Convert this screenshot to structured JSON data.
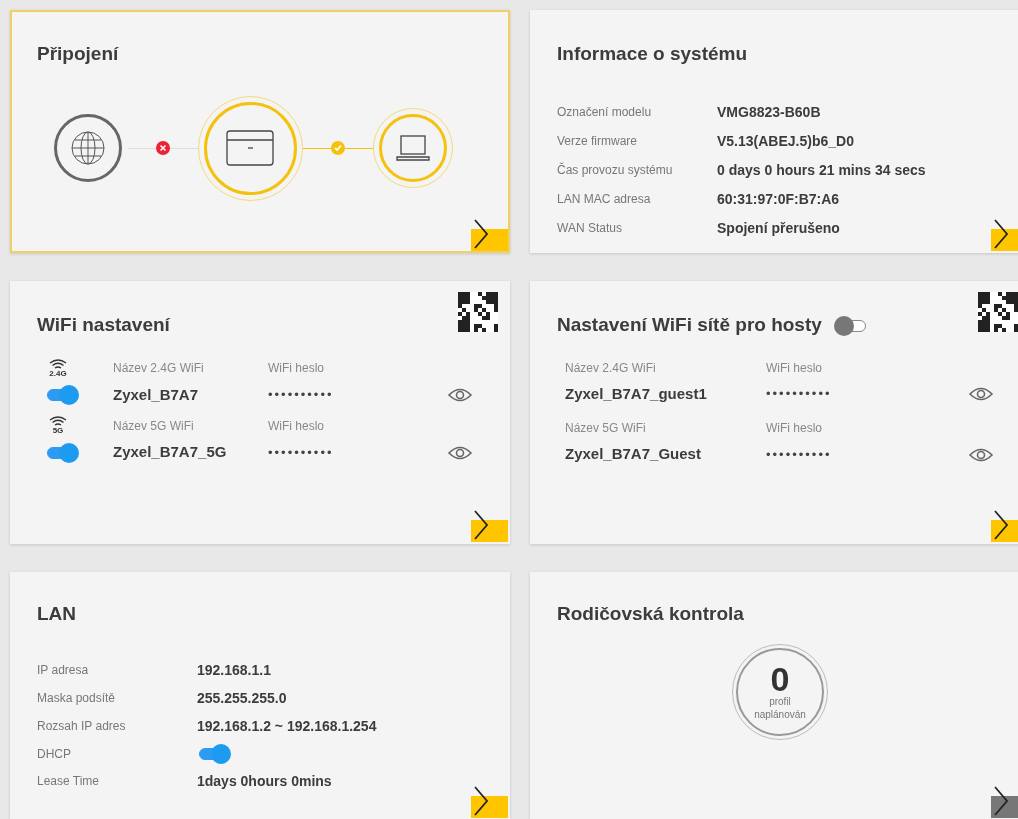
{
  "connection": {
    "title": "Připojení",
    "selected": true,
    "link_enabled": true,
    "internet_ok": false,
    "lan_ok": true
  },
  "system_info": {
    "title": "Informace o systému",
    "selected": false,
    "link_enabled": true,
    "rows": [
      {
        "label": "Označení modelu",
        "value": "VMG8823-B60B"
      },
      {
        "label": "Verze firmware",
        "value": "V5.13(ABEJ.5)b6_D0"
      },
      {
        "label": "Čas provozu systému",
        "value": "0 days 0 hours 21 mins 34 secs"
      },
      {
        "label": "LAN MAC adresa",
        "value": "60:31:97:0F:B7:A6"
      },
      {
        "label": "WAN Status",
        "value": "Spojení přerušeno"
      }
    ]
  },
  "wifi": {
    "title": "WiFi nastavení",
    "selected": false,
    "link_enabled": true,
    "networks": [
      {
        "band": "2.4G",
        "on": true,
        "name_label": "Název 2.4G WiFi",
        "name": "Zyxel_B7A7",
        "password_label": "WiFi heslo",
        "password": "••••••••••"
      },
      {
        "band": "5G",
        "on": true,
        "name_label": "Název 5G WiFi",
        "name": "Zyxel_B7A7_5G",
        "password_label": "WiFi heslo",
        "password": "••••••••••"
      }
    ]
  },
  "guest_wifi": {
    "title": "Nastavení WiFi sítě pro hosty",
    "selected": false,
    "link_enabled": true,
    "on": false,
    "networks": [
      {
        "name_label": "Název 2.4G WiFi",
        "name": "Zyxel_B7A7_guest1",
        "password_label": "WiFi heslo",
        "password": "••••••••••"
      },
      {
        "name_label": "Název 5G WiFi",
        "name": "Zyxel_B7A7_Guest",
        "password_label": "WiFi heslo",
        "password": "••••••••••"
      }
    ]
  },
  "lan": {
    "title": "LAN",
    "selected": false,
    "link_enabled": true,
    "rows": [
      {
        "kind": "text",
        "label": "IP adresa",
        "value": "192.168.1.1"
      },
      {
        "kind": "text",
        "label": "Maska podsítě",
        "value": "255.255.255.0"
      },
      {
        "kind": "text",
        "label": "Rozsah IP adres",
        "value": "192.168.1.2 ~ 192.168.1.254"
      },
      {
        "kind": "toggle",
        "label": "DHCP",
        "on": true
      },
      {
        "kind": "text",
        "label": "Lease Time",
        "value": "1days 0hours 0mins"
      }
    ]
  },
  "parental": {
    "title": "Rodičovská kontrola",
    "selected": false,
    "link_enabled": false,
    "count": "0",
    "caption": "profil naplánován"
  }
}
